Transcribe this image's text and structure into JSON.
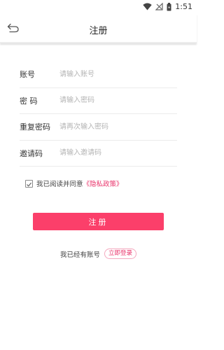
{
  "status_bar": {
    "time": "1:51",
    "icons": [
      "wifi-icon",
      "signal-off-icon",
      "battery-icon"
    ]
  },
  "app_bar": {
    "title": "注册",
    "back_icon": "back-arrow-icon"
  },
  "form": {
    "rows": [
      {
        "label": "账号",
        "placeholder": "请输入账号",
        "value": ""
      },
      {
        "label": "密 码",
        "placeholder": "请输入密码",
        "value": ""
      },
      {
        "label": "重复密码",
        "placeholder": "请再次输入密码",
        "value": ""
      },
      {
        "label": "邀请码",
        "placeholder": "请输入邀请码",
        "value": ""
      }
    ]
  },
  "agreement": {
    "checked": true,
    "text": "我已阅读并同意",
    "policy_link": "《隐私政策》"
  },
  "register_button": {
    "label": "注册"
  },
  "login": {
    "prompt": "我已经有账号",
    "link_label": "立即登录"
  },
  "colors": {
    "accent": "#fb3f6a",
    "link": "#e9336a"
  }
}
